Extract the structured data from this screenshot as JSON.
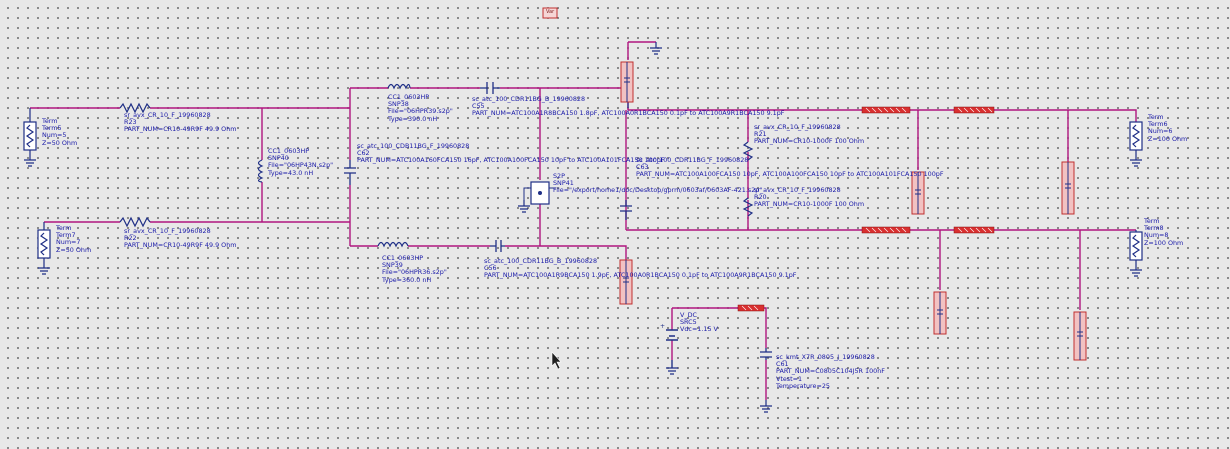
{
  "schematic": {
    "labels": {
      "var_box": "Var",
      "term5": [
        "Term",
        "Term5",
        "Num=5",
        "Z=50 Ohm"
      ],
      "term7": [
        "Term",
        "Term7",
        "Num=7",
        "Z=50 Ohm"
      ],
      "r23": [
        "sr_avx_CR_10_F_19960828",
        "R23",
        "PART_NUM=CR10-49R9F 49.9 Ohm"
      ],
      "r22": [
        "sr_avx_CR_10_F_19960828",
        "R22",
        "PART_NUM=CR10-49R9F 49.9 Ohm"
      ],
      "snp40": [
        "CC1_0603HP",
        "SNP40",
        "File=\"06HP43N.s2p\"",
        "Type=43.0 nH"
      ],
      "snp38": [
        "CC1_0603HP",
        "SNP38",
        "File=\"06HPR39.s2p\"",
        "Type=390.0 nH"
      ],
      "snp39": [
        "CC1_0603HP",
        "SNP39",
        "File=\"06HPR36.s2p\"",
        "Type=360.0 nH"
      ],
      "c62": [
        "sc_atc_100_CDB11BG_F_19960828",
        "C62",
        "PART_NUM=ATC100A160FCA150 16pF, ATC100A100FCA150 10pF to ATC100A101FCA150 100pF"
      ],
      "c55": [
        "sc_atc_100_CDR11BG_B_19960828",
        "C55",
        "PART_NUM=ATC100A1R8BCA150 1.8pF, ATC100A0R1BCA150 0.1pF to ATC100A9R1BCA150 9.1pF"
      ],
      "c56": [
        "sc_atc_100_CDR11BG_B_19960828",
        "C56",
        "PART_NUM=ATC100A1R9BCA150 1.9pF, ATC100A0R1BCA150 0.1pF to ATC100A9R1BCA150 9.1pF"
      ],
      "c63": [
        "sc_atc_100_CDR11BG_F_19960828",
        "C63",
        "PART_NUM=ATC100A100FCA150 10pF, ATC100A100FCA150 10pF to ATC100A101FCA150 100pF"
      ],
      "s2p": [
        "S2P",
        "SNP41",
        "File=\"/export/home1/doc/Desktop/gprm/0603af/0603AF-421.s2p\""
      ],
      "r21": [
        "sr_avx_CR_10_F_19960828",
        "R21",
        "PART_NUM=CR10-1000F 100 Ohm"
      ],
      "r20": [
        "sr_avx_CR_10_F_19960828",
        "R20",
        "PART_NUM=CR10-1000F 100 Ohm"
      ],
      "term6": [
        "Term",
        "Term6",
        "Num=6",
        "Z=100 Ohm"
      ],
      "term8": [
        "Term",
        "Term8",
        "Num=8",
        "Z=100 Ohm"
      ],
      "vdc": [
        "V_DC",
        "SRC5",
        "Vdc=1.15 V"
      ],
      "c61": [
        "sc_kmt_X7R_0805_J_19960828",
        "C61",
        "PART_NUM=C0805C104J5R 100nF",
        "Vtest=1",
        "Temperature=25"
      ]
    }
  }
}
